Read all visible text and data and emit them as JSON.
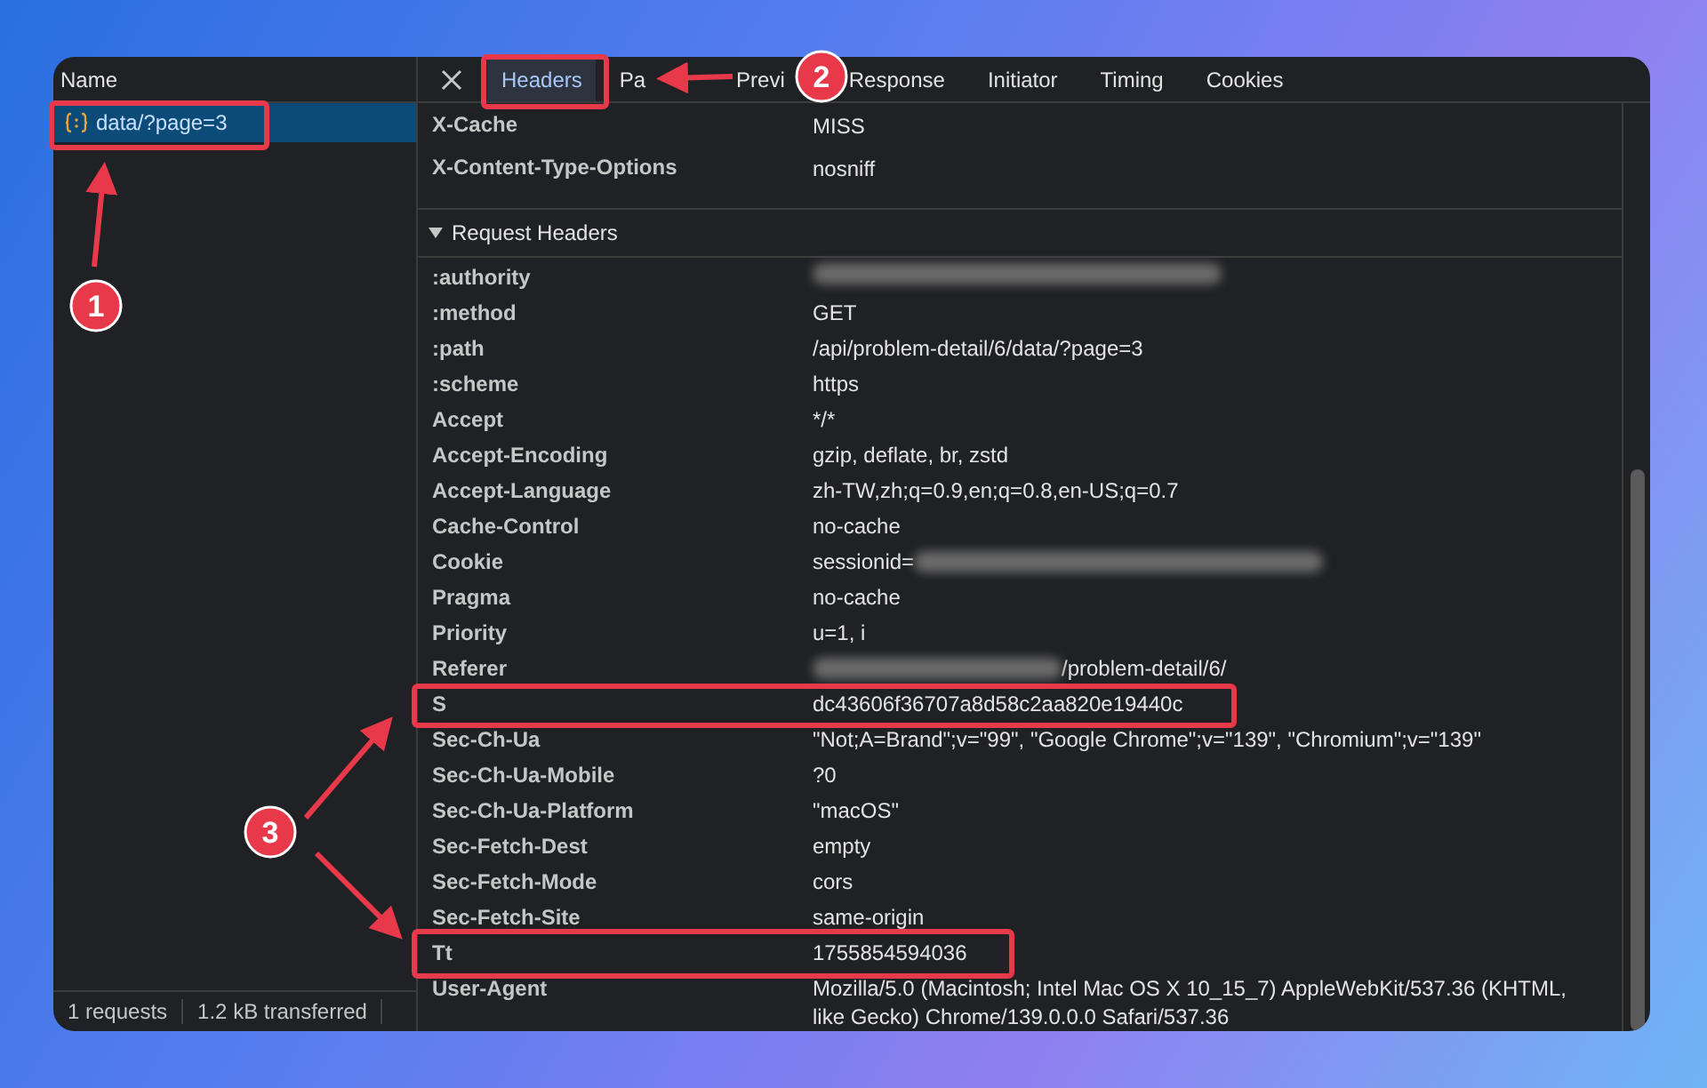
{
  "requests_panel": {
    "column_header": "Name",
    "rows": [
      {
        "name": "data/?page=3",
        "selected": true
      }
    ],
    "status": [
      "1 requests",
      "1.2 kB transferred"
    ]
  },
  "details": {
    "tabs": [
      {
        "label": "Headers",
        "selected": true
      },
      {
        "label": "Pa",
        "selected": false
      },
      {
        "label": "Previ",
        "selected": false
      },
      {
        "label": "Response",
        "selected": false
      },
      {
        "label": "Initiator",
        "selected": false
      },
      {
        "label": "Timing",
        "selected": false
      },
      {
        "label": "Cookies",
        "selected": false
      }
    ],
    "response_rows": [
      {
        "name": "X-Cache",
        "parts": [
          {
            "kind": "text",
            "text": "MISS"
          }
        ]
      },
      {
        "name": "X-Content-Type-Options",
        "parts": [
          {
            "kind": "text",
            "text": "nosniff"
          }
        ]
      }
    ],
    "request_section": {
      "title": "Request Headers",
      "expanded": true,
      "rows": [
        {
          "name": ":authority",
          "parts": [
            {
              "kind": "blurred"
            }
          ]
        },
        {
          "name": ":method",
          "parts": [
            {
              "kind": "text",
              "text": "GET"
            }
          ]
        },
        {
          "name": ":path",
          "parts": [
            {
              "kind": "text",
              "text": "/api/problem-detail/6/data/?page=3"
            }
          ]
        },
        {
          "name": ":scheme",
          "parts": [
            {
              "kind": "text",
              "text": "https"
            }
          ]
        },
        {
          "name": "Accept",
          "parts": [
            {
              "kind": "text",
              "text": "*/*"
            }
          ]
        },
        {
          "name": "Accept-Encoding",
          "parts": [
            {
              "kind": "text",
              "text": "gzip, deflate, br, zstd"
            }
          ]
        },
        {
          "name": "Accept-Language",
          "parts": [
            {
              "kind": "text",
              "text": "zh-TW,zh;q=0.9,en;q=0.8,en-US;q=0.7"
            }
          ]
        },
        {
          "name": "Cache-Control",
          "parts": [
            {
              "kind": "text",
              "text": "no-cache"
            }
          ]
        },
        {
          "name": "Cookie",
          "parts": [
            {
              "kind": "text",
              "text": "sessionid="
            },
            {
              "kind": "blurred"
            }
          ]
        },
        {
          "name": "Pragma",
          "parts": [
            {
              "kind": "text",
              "text": "no-cache"
            }
          ]
        },
        {
          "name": "Priority",
          "parts": [
            {
              "kind": "text",
              "text": "u=1, i"
            }
          ]
        },
        {
          "name": "Referer",
          "parts": [
            {
              "kind": "blurred"
            },
            {
              "kind": "text",
              "text": "/problem-detail/6/"
            }
          ]
        },
        {
          "name": "S",
          "parts": [
            {
              "kind": "text",
              "text": "dc43606f36707a8d58c2aa820e19440c"
            }
          ]
        },
        {
          "name": "Sec-Ch-Ua",
          "parts": [
            {
              "kind": "text",
              "text": "\"Not;A=Brand\";v=\"99\", \"Google Chrome\";v=\"139\", \"Chromium\";v=\"139\""
            }
          ]
        },
        {
          "name": "Sec-Ch-Ua-Mobile",
          "parts": [
            {
              "kind": "text",
              "text": "?0"
            }
          ]
        },
        {
          "name": "Sec-Ch-Ua-Platform",
          "parts": [
            {
              "kind": "text",
              "text": "\"macOS\""
            }
          ]
        },
        {
          "name": "Sec-Fetch-Dest",
          "parts": [
            {
              "kind": "text",
              "text": "empty"
            }
          ]
        },
        {
          "name": "Sec-Fetch-Mode",
          "parts": [
            {
              "kind": "text",
              "text": "cors"
            }
          ]
        },
        {
          "name": "Sec-Fetch-Site",
          "parts": [
            {
              "kind": "text",
              "text": "same-origin"
            }
          ]
        },
        {
          "name": "Tt",
          "parts": [
            {
              "kind": "text",
              "text": "1755854594036"
            }
          ]
        },
        {
          "name": "User-Agent",
          "parts": [
            {
              "kind": "text",
              "text": "Mozilla/5.0 (Macintosh; Intel Mac OS X 10_15_7) AppleWebKit/537.36 (KHTML, like Gecko) Chrome/139.0.0.0 Safari/537.36"
            }
          ]
        }
      ]
    }
  },
  "annotations": {
    "badges": [
      "1",
      "2",
      "3"
    ]
  }
}
